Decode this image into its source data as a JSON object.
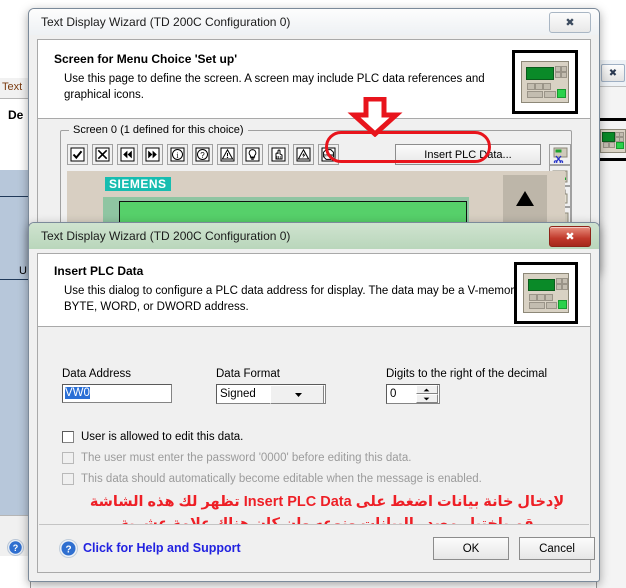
{
  "background_window": {
    "tab_label": "Text",
    "heading_fragment": "De",
    "side_fragment": "U",
    "help_icon": "help-circle-icon",
    "right_close_icon": "close-icon"
  },
  "dialog1": {
    "title": "Text Display Wizard (TD 200C Configuration 0)",
    "close_icon": "close-icon",
    "header": {
      "title": "Screen for Menu Choice 'Set up'",
      "description": "Use this page to define the screen. A screen may include PLC data references and graphical icons.",
      "thumbnail_icon": "td200c-display-icon"
    },
    "group": {
      "legend": "Screen 0 (1 defined for this choice)",
      "toolbar_icons": [
        "checkmark-icon",
        "cross-icon",
        "rewind-icon",
        "fast-forward-icon",
        "info-icon",
        "question-icon",
        "warning-icon",
        "lamp-icon",
        "hand-icon",
        "electrical-hazard-icon",
        "stop-icon"
      ],
      "insert_button": "Insert PLC Data...",
      "right_icons": [
        "cut-icon",
        "copy-icon",
        "paste-icon",
        "delete-icon"
      ]
    },
    "preview": {
      "brand": "SIEMENS",
      "key_icon": "up-arrow-key-icon"
    }
  },
  "annotations": {
    "arrow_icon": "red-down-arrow-icon",
    "highlight_icon": "red-oval-highlight",
    "color": "#e8141c"
  },
  "dialog2": {
    "title": "Text Display Wizard (TD 200C Configuration 0)",
    "close_icon": "close-icon",
    "header": {
      "title": "Insert PLC Data",
      "description": "Use this dialog to configure a PLC data address for display. The data may be a V-memory BYTE, WORD, or DWORD address.",
      "thumbnail_icon": "td200c-display-icon"
    },
    "fields": {
      "data_address": {
        "label": "Data Address",
        "value": "VW0"
      },
      "data_format": {
        "label": "Data Format",
        "value": "Signed",
        "dropdown_icon": "chevron-down-icon"
      },
      "digits": {
        "label": "Digits to the right of the decimal",
        "value": "0",
        "up_icon": "spinner-up-icon",
        "down_icon": "spinner-down-icon"
      }
    },
    "checkboxes": [
      {
        "label": "User is allowed to edit this data.",
        "checked": false,
        "disabled": false
      },
      {
        "label": "The user must enter the password '0000' before editing this data.",
        "checked": false,
        "disabled": true
      },
      {
        "label": "This data should automatically become editable when the message is enabled.",
        "checked": false,
        "disabled": true
      }
    ],
    "note": {
      "line1": "لإدخال خانة بيانات اضغط على Insert PLC Data تظهر لك هذه الشاشة",
      "line2": "قم باختيار مصدر البيانات ونوعه وإن كان هناك علامة عشرية"
    },
    "footer": {
      "help_icon": "help-circle-icon",
      "help_text": "Click for Help and Support",
      "ok": "OK",
      "cancel": "Cancel"
    }
  }
}
